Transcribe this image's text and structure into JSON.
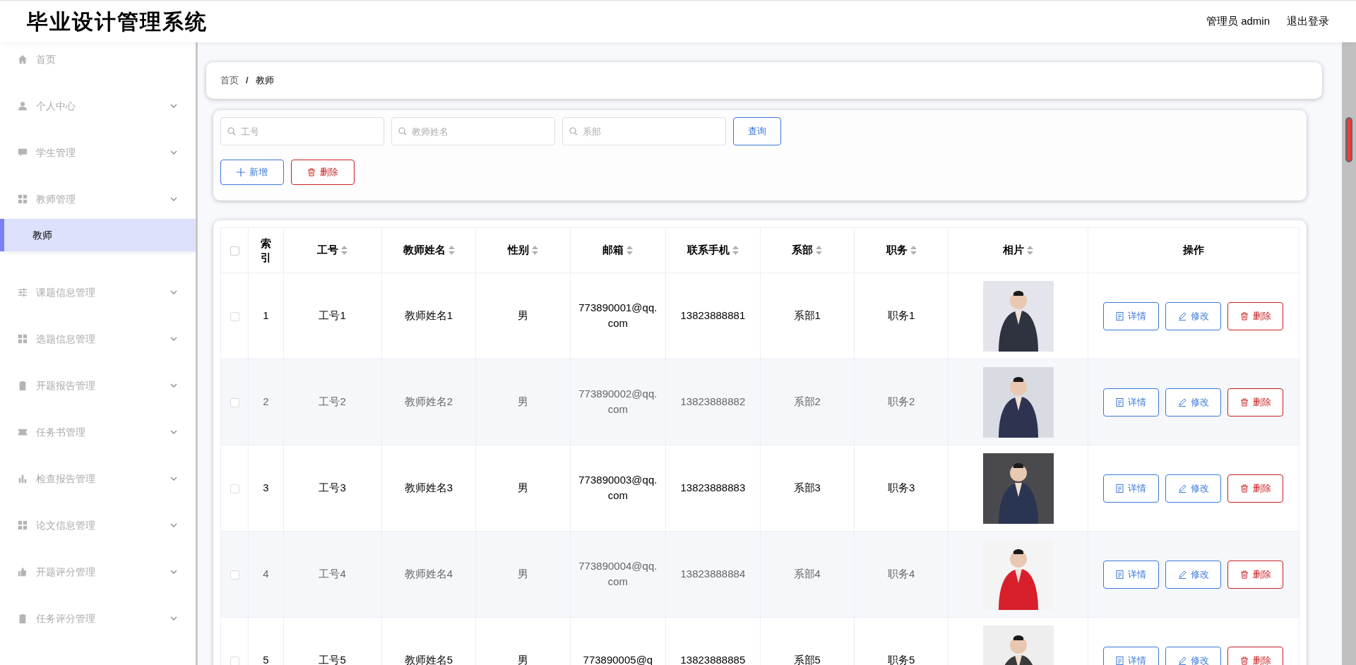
{
  "header": {
    "title": "毕业设计管理系统",
    "user": "管理员 admin",
    "logout": "退出登录"
  },
  "sidebar": {
    "items": [
      {
        "label": "首页",
        "kind": "link"
      },
      {
        "label": "个人中心",
        "kind": "submenu"
      },
      {
        "label": "学生管理",
        "kind": "submenu"
      },
      {
        "label": "教师管理",
        "kind": "submenu",
        "children": [
          {
            "label": "教师",
            "selected": true
          }
        ]
      },
      {
        "label": "课题信息管理",
        "kind": "submenu"
      },
      {
        "label": "选题信息管理",
        "kind": "submenu"
      },
      {
        "label": "开题报告管理",
        "kind": "submenu"
      },
      {
        "label": "任务书管理",
        "kind": "submenu"
      },
      {
        "label": "检查报告管理",
        "kind": "submenu"
      },
      {
        "label": "论文信息管理",
        "kind": "submenu"
      },
      {
        "label": "开题评分管理",
        "kind": "submenu"
      },
      {
        "label": "任务评分管理",
        "kind": "submenu"
      }
    ]
  },
  "breadcrumb": {
    "items": [
      "首页",
      "教师"
    ],
    "separator": "/"
  },
  "search": {
    "fields": [
      {
        "placeholder": "工号"
      },
      {
        "placeholder": "教师姓名"
      },
      {
        "placeholder": "系部"
      }
    ],
    "query_button": "查询",
    "add_button": "新增",
    "delete_button": "删除"
  },
  "table": {
    "select_all_checked": false,
    "columns": [
      {
        "label": "索引",
        "sortable": false
      },
      {
        "label": "工号",
        "sortable": true
      },
      {
        "label": "教师姓名",
        "sortable": true
      },
      {
        "label": "性别",
        "sortable": true
      },
      {
        "label": "邮箱",
        "sortable": true
      },
      {
        "label": "联系手机",
        "sortable": true
      },
      {
        "label": "系部",
        "sortable": true
      },
      {
        "label": "职务",
        "sortable": true
      },
      {
        "label": "相片",
        "sortable": true
      },
      {
        "label": "操作",
        "sortable": false
      }
    ],
    "rows": [
      {
        "checked": false,
        "index": "1",
        "id": "工号1",
        "name": "教师姓名1",
        "gender": "男",
        "email": "773890001@qq.com",
        "phone": "13823888881",
        "dept": "系部1",
        "post": "职务1",
        "actions": {
          "detail": "详情",
          "edit": "修改",
          "delete": "删除"
        }
      },
      {
        "checked": false,
        "index": "2",
        "id": "工号2",
        "name": "教师姓名2",
        "gender": "男",
        "email": "773890002@qq.com",
        "phone": "13823888882",
        "dept": "系部2",
        "post": "职务2",
        "actions": {
          "detail": "详情",
          "edit": "修改",
          "delete": "删除"
        }
      },
      {
        "checked": false,
        "index": "3",
        "id": "工号3",
        "name": "教师姓名3",
        "gender": "男",
        "email": "773890003@qq.com",
        "phone": "13823888883",
        "dept": "系部3",
        "post": "职务3",
        "actions": {
          "detail": "详情",
          "edit": "修改",
          "delete": "删除"
        }
      },
      {
        "checked": false,
        "index": "4",
        "id": "工号4",
        "name": "教师姓名4",
        "gender": "男",
        "email": "773890004@qq.com",
        "phone": "13823888884",
        "dept": "系部4",
        "post": "职务4",
        "actions": {
          "detail": "详情",
          "edit": "修改",
          "delete": "删除"
        }
      },
      {
        "checked": false,
        "index": "5",
        "id": "工号5",
        "name": "教师姓名5",
        "gender": "男",
        "email": "773890005@q",
        "phone": "13823888885",
        "dept": "系部5",
        "post": "职务5",
        "actions": {
          "detail": "详情",
          "edit": "修改",
          "delete": "删除"
        }
      }
    ]
  }
}
